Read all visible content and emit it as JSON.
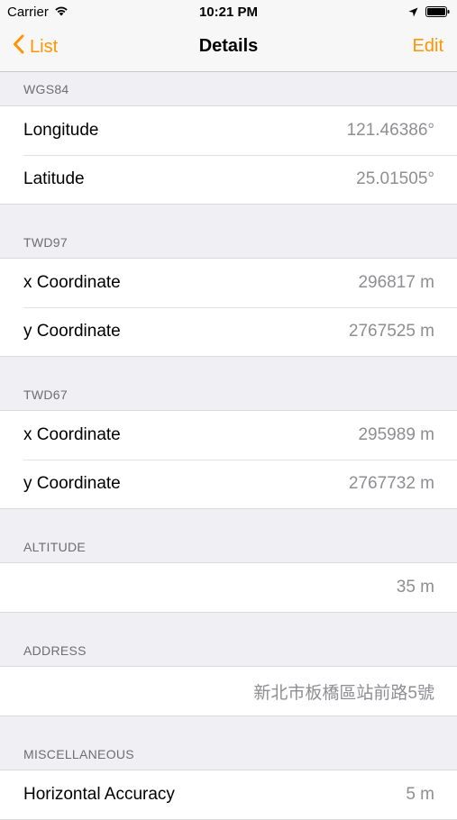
{
  "status_bar": {
    "carrier": "Carrier",
    "time": "10:21 PM"
  },
  "nav": {
    "back_label": "List",
    "title": "Details",
    "edit_label": "Edit"
  },
  "sections": {
    "wgs84": {
      "header": "WGS84",
      "longitude_label": "Longitude",
      "longitude_value": "121.46386°",
      "latitude_label": "Latitude",
      "latitude_value": "25.01505°"
    },
    "twd97": {
      "header": "TWD97",
      "x_label": "x Coordinate",
      "x_value": "296817 m",
      "y_label": "y Coordinate",
      "y_value": "2767525 m"
    },
    "twd67": {
      "header": "TWD67",
      "x_label": "x Coordinate",
      "x_value": "295989 m",
      "y_label": "y Coordinate",
      "y_value": "2767732 m"
    },
    "altitude": {
      "header": "ALTITUDE",
      "value": "35 m"
    },
    "address": {
      "header": "ADDRESS",
      "value": "新北市板橋區站前路5號"
    },
    "misc": {
      "header": "MISCELLANEOUS",
      "horizontal_accuracy_label": "Horizontal Accuracy",
      "horizontal_accuracy_value": "5 m"
    }
  },
  "colors": {
    "accent": "#ff9500",
    "background": "#efeff4",
    "secondary_text": "#8e8e93",
    "header_text": "#6d6d72"
  },
  "icons": [
    "wifi-icon",
    "location-arrow-icon",
    "battery-icon",
    "chevron-left-icon"
  ]
}
